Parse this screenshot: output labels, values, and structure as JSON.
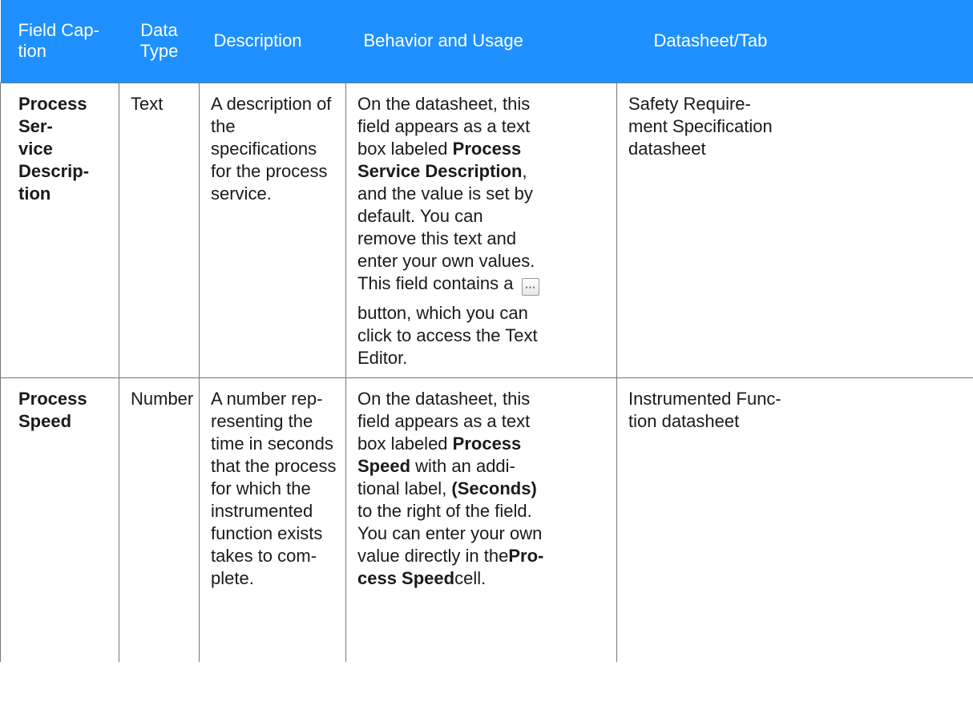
{
  "headers": {
    "field_caption": "Field Cap-\ntion",
    "data_type": "Data\nType",
    "description": "Description",
    "behavior": "Behavior and Usage",
    "datasheet": "Datasheet/Tab"
  },
  "rows": [
    {
      "caption": "Process Ser-\nvice Descrip-\ntion",
      "type": "Text",
      "description": "A description of\nthe specifications\nfor the process\nservice.",
      "behavior": {
        "part1": "On the datasheet, this\nfield appears as a text\nbox labeled ",
        "bold1": "Process\nService Description",
        "part2": ",\nand the value is set by\ndefault. You can\nremove this text and\nenter your own values.\nThis field contains a",
        "button_icon": "ellipsis-button-icon",
        "part3": "button, which you can\nclick to access the Text\nEditor."
      },
      "datasheet": "Safety Require-\nment Specification\ndatasheet"
    },
    {
      "caption": "Process\nSpeed",
      "type": "Number",
      "description": "A number rep-\nresenting the\ntime in seconds\nthat the process\nfor which the\ninstrumented\nfunction exists\ntakes to com-\nplete.",
      "behavior": {
        "part1": "On the datasheet, this\nfield appears as a text\nbox labeled ",
        "bold1": "Process\nSpeed",
        "part2": " with an addi-\ntional label, ",
        "bold2": "(Seconds)",
        "part3": "\nto the right of the field.\nYou can enter your own\nvalue directly in the",
        "bold3": "Pro-\ncess Speed",
        "part4": "cell."
      },
      "datasheet": "Instrumented Func-\ntion datasheet"
    }
  ],
  "colors": {
    "header_bg": "#1e90ff",
    "header_text": "#ffffff",
    "border": "#777777"
  }
}
